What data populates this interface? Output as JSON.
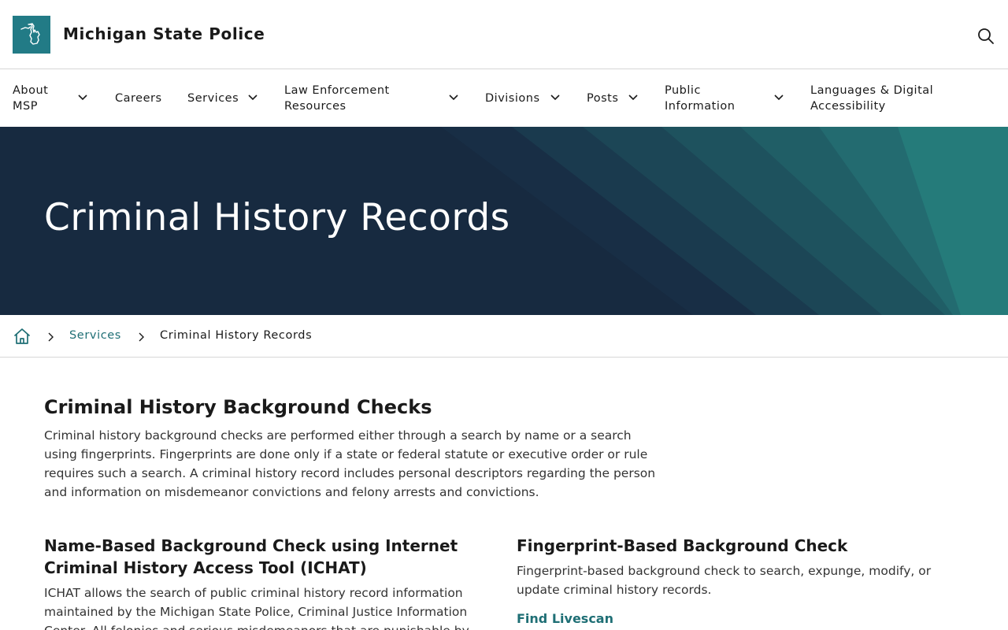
{
  "header": {
    "site_title": "Michigan State Police",
    "logo_icon": "michigan-map-icon",
    "search_icon": "search-icon"
  },
  "nav": {
    "items": [
      {
        "label": "About MSP",
        "has_dropdown": true
      },
      {
        "label": "Careers",
        "has_dropdown": false
      },
      {
        "label": "Services",
        "has_dropdown": true
      },
      {
        "label": "Law Enforcement Resources",
        "has_dropdown": true
      },
      {
        "label": "Divisions",
        "has_dropdown": true
      },
      {
        "label": "Posts",
        "has_dropdown": true
      },
      {
        "label": "Public Information",
        "has_dropdown": true
      },
      {
        "label": "Languages & Digital Accessibility",
        "has_dropdown": false
      }
    ]
  },
  "hero": {
    "title": "Criminal History Records"
  },
  "breadcrumb": {
    "home_icon": "home-icon",
    "items": [
      {
        "label": "Services",
        "link": true
      },
      {
        "label": "Criminal History Records",
        "link": false
      }
    ]
  },
  "content": {
    "heading": "Criminal History Background Checks",
    "intro": "Criminal history background checks are performed either through a search by name or a search using fingerprints. Fingerprints are done only if a state or federal statute or executive order or rule requires such a search. A criminal history record includes personal descriptors regarding the person and information on misdemeanor convictions and felony arrests and convictions.",
    "left": {
      "heading": "Name-Based Background Check using Internet Criminal History Access Tool (ICHAT)",
      "body": "ICHAT allows the search of public criminal history record information maintained by the Michigan State Police, Criminal Justice Information Center. All felonies and serious misdemeanors that are punishable by"
    },
    "right": {
      "heading": "Fingerprint-Based Background Check",
      "body": "Fingerprint-based background check to search, expunge, modify, or update criminal history records.",
      "link": "Find Livescan"
    }
  },
  "colors": {
    "brand_teal": "#227b86",
    "link_teal": "#1f6f75",
    "hero_navy": "#172a40"
  }
}
